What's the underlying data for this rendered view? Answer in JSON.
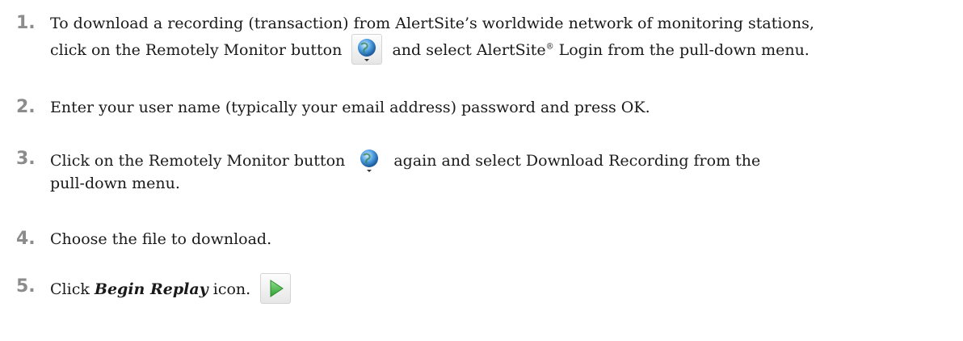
{
  "steps": [
    {
      "number": "1.",
      "line1": "To download a recording (transaction) from AlertSite’s worldwide network of monitoring stations,",
      "line2_before": "click on the Remotely Monitor button",
      "line2_after_a": "and select AlertSite",
      "line2_sup": "®",
      "line2_after_b": " Login from the pull-down menu."
    },
    {
      "number": "2.",
      "text": "Enter your user name (typically your email address) password and press OK."
    },
    {
      "number": "3.",
      "line1_before": "Click on the Remotely Monitor button",
      "line1_after": "again and select Download Recording from the",
      "line2": "pull-down menu."
    },
    {
      "number": "4.",
      "text": "Choose the file to download."
    },
    {
      "number": "5.",
      "before": "Click ",
      "bold": "Begin Replay",
      "after": " icon."
    }
  ],
  "icons": {
    "remote": "remotely-monitor-globe-icon",
    "play": "begin-replay-play-icon"
  },
  "colors": {
    "step_number": "#8c8c8c",
    "globe": "#3a8fd6",
    "play": "#3cb63c"
  }
}
